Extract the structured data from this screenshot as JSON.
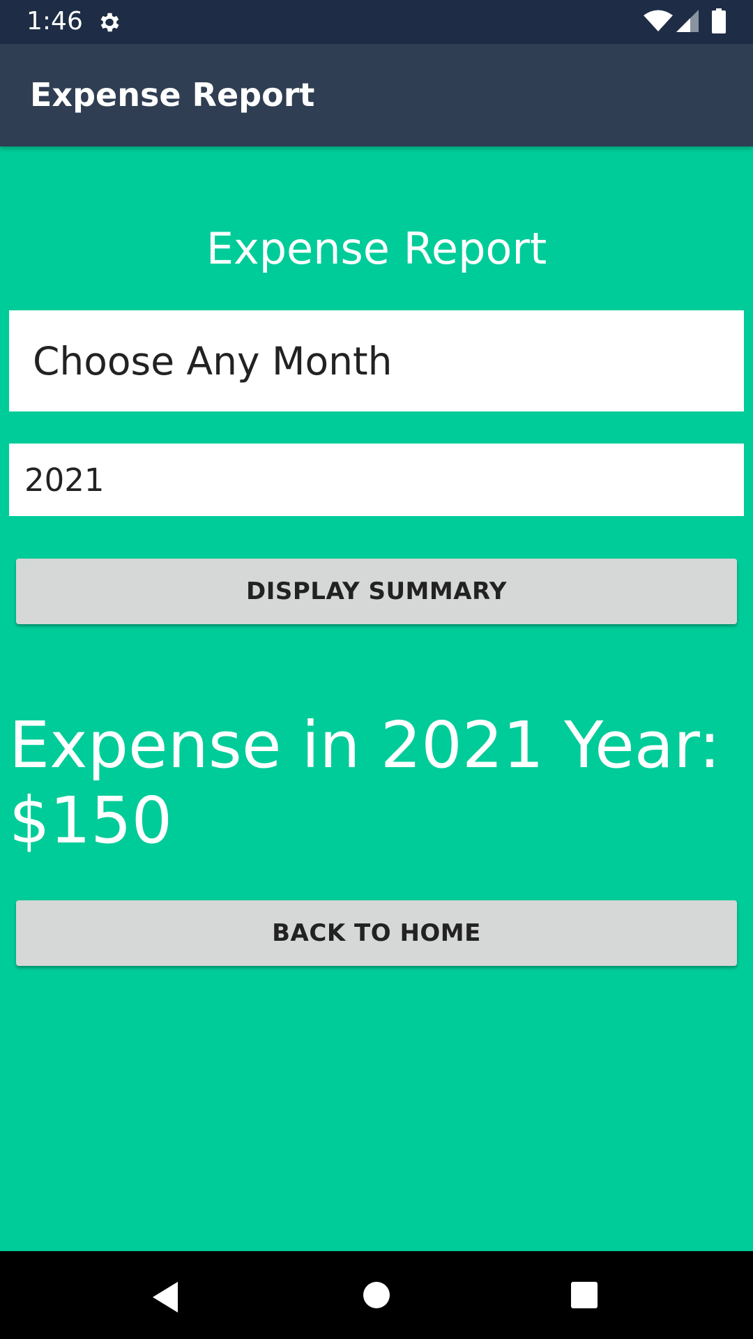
{
  "status_bar": {
    "time": "1:46",
    "icons": [
      "gear-icon",
      "wifi-icon",
      "cell-signal-icon",
      "battery-icon"
    ]
  },
  "app_bar": {
    "title": "Expense Report"
  },
  "main": {
    "heading": "Expense Report",
    "month_select_value": "Choose Any Month",
    "year_input_value": "2021",
    "display_summary_label": "DISPLAY SUMMARY",
    "result_line1": "Expense in 2021 Year:",
    "result_line2": "$150",
    "back_home_label": "BACK TO HOME"
  },
  "nav_bar": {
    "icons": [
      "back-icon",
      "home-icon",
      "recents-icon"
    ]
  },
  "colors": {
    "background": "#00CC99",
    "status_bar": "#1E2D45",
    "app_bar": "#2F3E52",
    "button": "#D6D7D7"
  }
}
